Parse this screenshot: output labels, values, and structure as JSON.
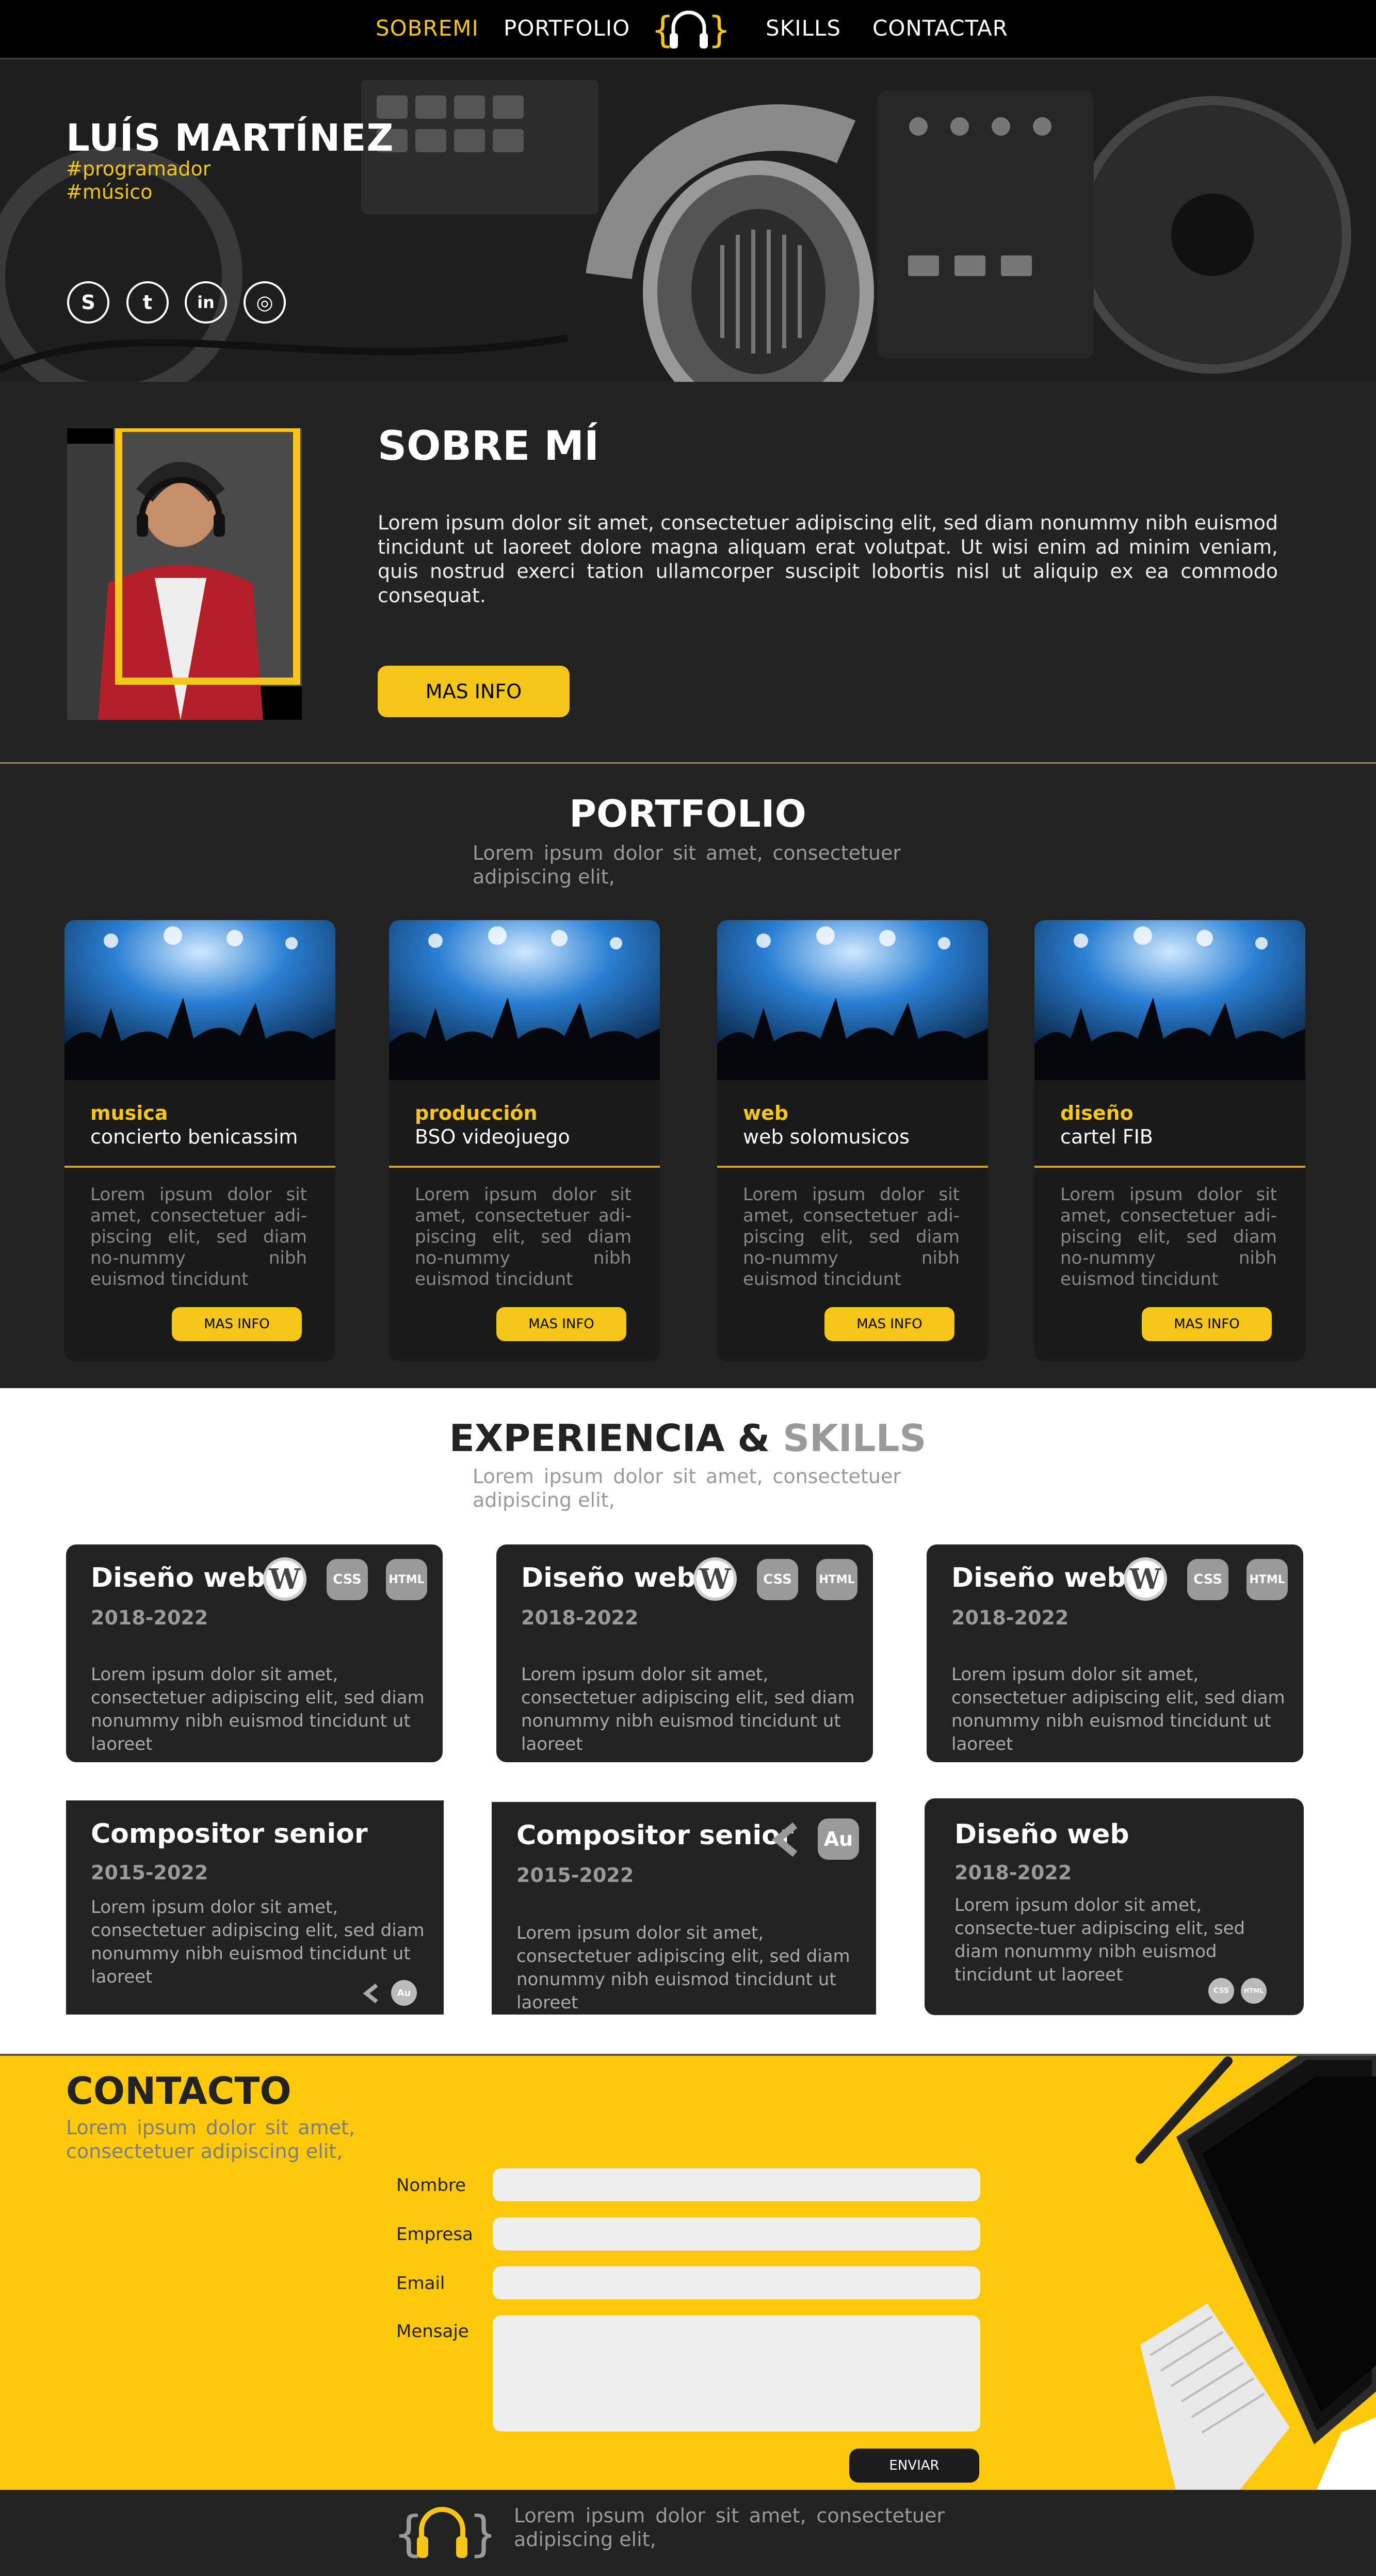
{
  "nav": {
    "items": [
      "SOBREMI",
      "PORTFOLIO",
      "SKILLS",
      "CONTACTAR"
    ],
    "active_color": "#f5c518"
  },
  "hero": {
    "name": "LUÍS MARTÍNEZ",
    "tags": [
      "#programador",
      "#músico"
    ],
    "social": [
      {
        "icon": "skype-icon",
        "glyph": "S"
      },
      {
        "icon": "twitter-icon",
        "glyph": "t"
      },
      {
        "icon": "linkedin-icon",
        "glyph": "in"
      },
      {
        "icon": "instagram-icon",
        "glyph": "◎"
      }
    ]
  },
  "about": {
    "title": "SOBRE MÍ",
    "text": "Lorem ipsum dolor sit amet, consectetuer adipiscing elit, sed diam nonummy nibh euismod tincidunt ut laoreet dolore magna aliquam erat volutpat. Ut wisi enim ad minim veniam, quis nostrud exerci tation ullamcorper suscipit lobortis nisl ut aliquip ex ea commodo consequat.",
    "button": "MAS INFO"
  },
  "portfolio": {
    "title": "PORTFOLIO",
    "subtitle": "Lorem ipsum dolor sit amet, consectetuer adipiscing elit,",
    "cards": [
      {
        "category": "musica",
        "name": "concierto benicassim",
        "text": "Lorem ipsum dolor sit amet, consectetuer adi-piscing elit, sed diam no-nummy nibh euismod tincidunt",
        "button": "MAS INFO"
      },
      {
        "category": "producción",
        "name": "BSO videojuego",
        "text": "Lorem ipsum dolor sit amet, consectetuer adi-piscing elit, sed diam no-nummy nibh euismod tincidunt",
        "button": "MAS INFO"
      },
      {
        "category": "web",
        "name": "web solomusicos",
        "text": "Lorem ipsum dolor sit amet, consectetuer adi-piscing elit, sed diam no-nummy nibh euismod tincidunt",
        "button": "MAS INFO"
      },
      {
        "category": "diseño",
        "name": "cartel FIB",
        "text": "Lorem ipsum dolor sit amet, consectetuer adi-piscing elit, sed diam no-nummy nibh euismod tincidunt",
        "button": "MAS INFO"
      }
    ]
  },
  "skills": {
    "title_main": "EXPERIENCIA &",
    "title_grey": "SKILLS",
    "subtitle": "Lorem ipsum dolor sit amet, consectetuer adipiscing elit,",
    "badges": {
      "wp": "W",
      "css": "CSS",
      "html": "HTML",
      "au": "Au"
    },
    "cards": [
      {
        "name": "Diseño web",
        "years": "2018-2022",
        "text": "Lorem ipsum dolor sit amet, consectetuer adipiscing elit, sed diam nonummy nibh euismod tincidunt ut laoreet"
      },
      {
        "name": "Diseño web",
        "years": "2018-2022",
        "text": "Lorem ipsum dolor sit amet, consectetuer adipiscing elit, sed diam nonummy nibh euismod tincidunt ut laoreet"
      },
      {
        "name": "Diseño web",
        "years": "2018-2022",
        "text": "Lorem ipsum dolor sit amet, consectetuer adipiscing elit, sed diam nonummy nibh euismod tincidunt ut laoreet"
      },
      {
        "name": "Compositor senior",
        "years": "2015-2022",
        "text": "Lorem ipsum dolor sit amet, consectetuer adipiscing elit, sed diam nonummy nibh euismod tincidunt ut laoreet"
      },
      {
        "name": "Compositor senior",
        "years": "2015-2022",
        "text": "Lorem ipsum dolor sit amet, consectetuer adipiscing elit, sed diam nonummy nibh euismod tincidunt ut laoreet"
      },
      {
        "name": "Diseño web",
        "years": "2018-2022",
        "text": "Lorem ipsum dolor sit amet, consecte-tuer adipiscing elit, sed diam nonummy nibh euismod tincidunt ut laoreet"
      }
    ]
  },
  "contact": {
    "title": "CONTACTO",
    "subtitle": "Lorem ipsum dolor sit amet, consectetuer adipiscing elit,",
    "labels": [
      "Nombre",
      "Empresa",
      "Email",
      "Mensaje"
    ],
    "send": "ENVIAR"
  },
  "footer": {
    "text": "Lorem ipsum dolor sit amet, consectetuer adipiscing elit,"
  },
  "colors": {
    "accent": "#f5c518",
    "dark": "#222222",
    "contact_bg": "#fec90a"
  }
}
